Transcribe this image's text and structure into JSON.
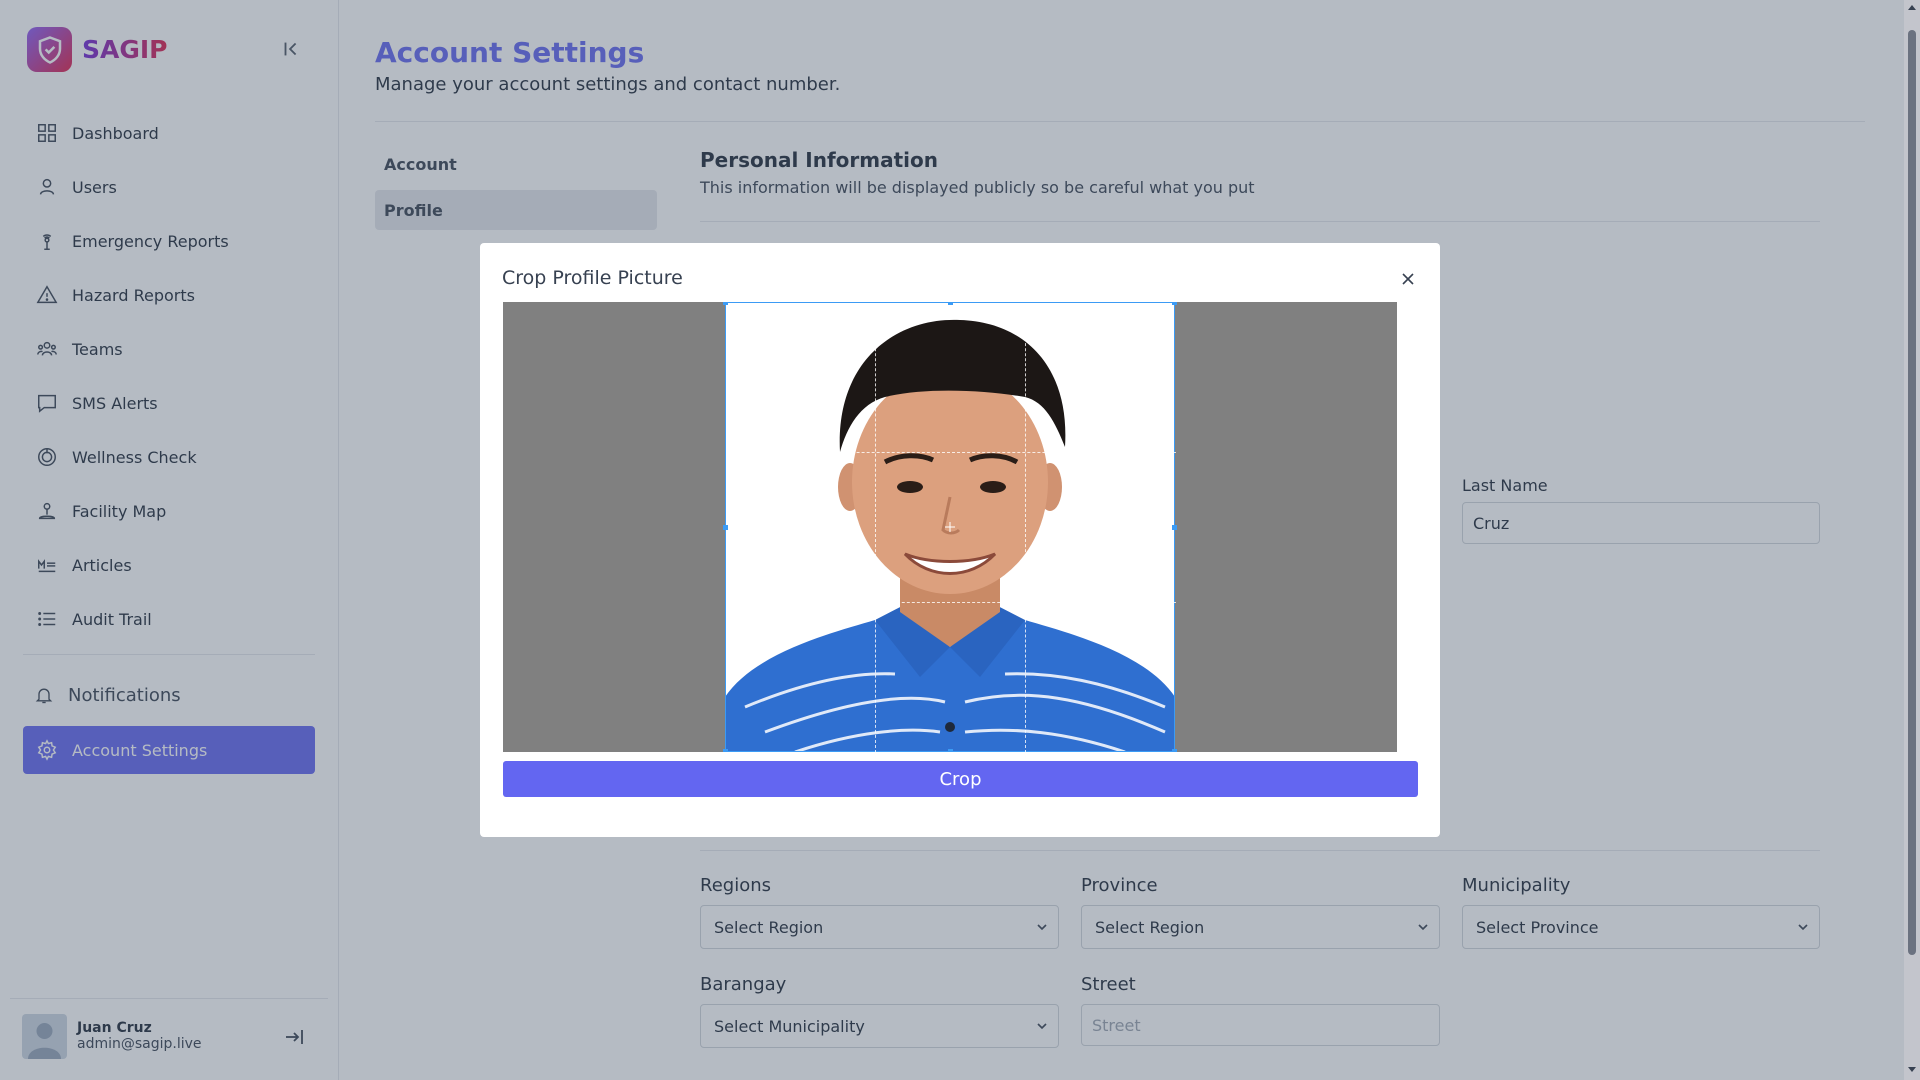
{
  "sidebar": {
    "brand": "SAGIP",
    "items": [
      {
        "label": "Dashboard",
        "icon": "grid-icon"
      },
      {
        "label": "Users",
        "icon": "user-icon"
      },
      {
        "label": "Emergency Reports",
        "icon": "signal-pin-icon"
      },
      {
        "label": "Hazard Reports",
        "icon": "warning-icon"
      },
      {
        "label": "Teams",
        "icon": "team-icon"
      },
      {
        "label": "SMS Alerts",
        "icon": "message-icon"
      },
      {
        "label": "Wellness Check",
        "icon": "heart-check-icon"
      },
      {
        "label": "Facility Map",
        "icon": "map-pin-icon"
      },
      {
        "label": "Articles",
        "icon": "article-icon"
      },
      {
        "label": "Audit Trail",
        "icon": "list-icon"
      }
    ],
    "notifications": "Notifications",
    "account_settings": "Account Settings",
    "user": {
      "name": "Juan Cruz",
      "email": "admin@sagip.live"
    }
  },
  "page": {
    "title": "Account Settings",
    "subtitle": "Manage your account settings and contact number.",
    "tabs": [
      "Account",
      "Profile"
    ],
    "active_tab": "Profile",
    "section_title": "Personal Information",
    "section_subtitle": "This information will be displayed publicly so be careful what you put"
  },
  "form": {
    "last_name_label": "Last Name",
    "last_name_value": "Cruz",
    "regions_label": "Regions",
    "regions_value": "Select Region",
    "province_label": "Province",
    "province_value": "Select Region",
    "municipality_label": "Municipality",
    "municipality_value": "Select Province",
    "barangay_label": "Barangay",
    "barangay_value": "Select Municipality",
    "street_label": "Street",
    "street_placeholder": "Street"
  },
  "modal": {
    "title": "Crop Profile Picture",
    "crop_button": "Crop"
  },
  "colors": {
    "accent": "#6366f1",
    "crop_border": "#3b9bf5",
    "shirt": "#2f6fd0"
  }
}
